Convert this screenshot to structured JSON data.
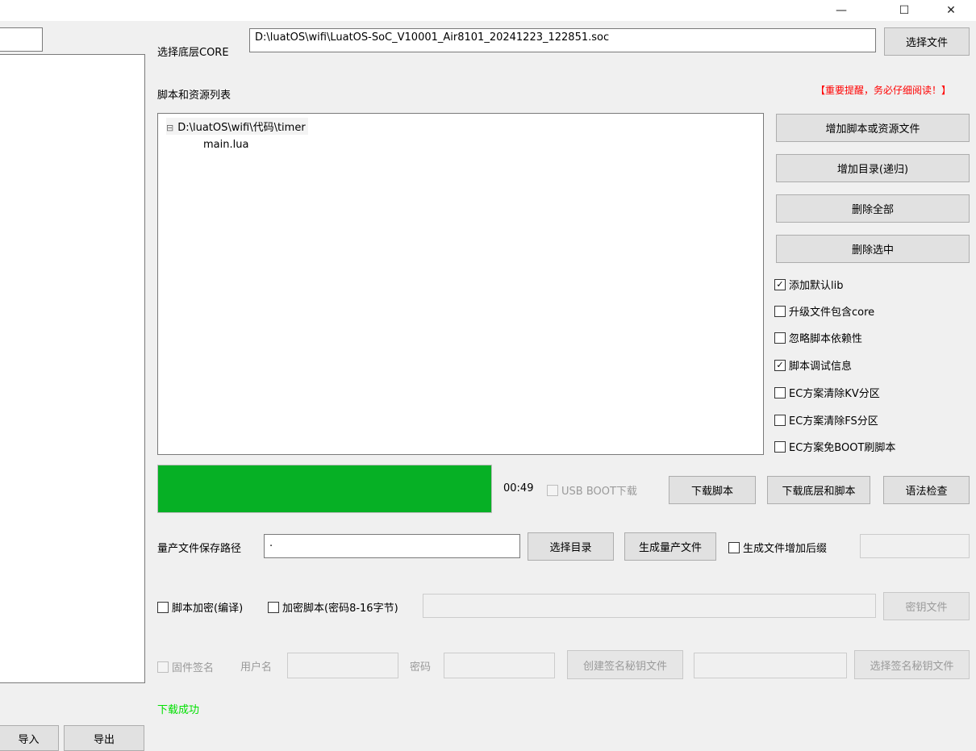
{
  "window": {
    "minimize_glyph": "—",
    "maximize_glyph": "☐",
    "close_glyph": "✕"
  },
  "core": {
    "label": "选择底层CORE",
    "path_value": "D:\\luatOS\\wifi\\LuatOS-SoC_V10001_Air8101_20241223_122851.soc",
    "select_button": "选择文件"
  },
  "scripts": {
    "label": "脚本和资源列表",
    "warning": "【重要提醒，务必仔细阅读！】",
    "tree": {
      "root_toggle": "⊟",
      "root_label": "D:\\luatOS\\wifi\\代码\\timer",
      "child_label": "main.lua"
    },
    "buttons": {
      "add_file": "增加脚本或资源文件",
      "add_dir": "增加目录(递归)",
      "delete_all": "删除全部",
      "delete_selected": "删除选中"
    },
    "options": [
      {
        "label": "添加默认lib",
        "checked": true
      },
      {
        "label": "升级文件包含core",
        "checked": false
      },
      {
        "label": "忽略脚本依赖性",
        "checked": false
      },
      {
        "label": "脚本调试信息",
        "checked": true
      },
      {
        "label": "EC方案清除KV分区",
        "checked": false
      },
      {
        "label": "EC方案清除FS分区",
        "checked": false
      },
      {
        "label": "EC方案免BOOT刷脚本",
        "checked": false
      }
    ]
  },
  "download": {
    "progress": 1.0,
    "progress_color": "#06b025",
    "elapsed": "00:49",
    "usb_boot_label": "USB BOOT下载",
    "download_script": "下载脚本",
    "download_core_and_script": "下载底层和脚本",
    "syntax_check": "语法检查"
  },
  "production": {
    "label": "量产文件保存路径",
    "path_value": ".",
    "select_dir": "选择目录",
    "generate": "生成量产文件",
    "suffix_label": "生成文件增加后缀"
  },
  "encryption": {
    "compile_encrypt": "脚本加密(编译)",
    "encrypt_script": "加密脚本(密码8-16字节)",
    "key_file": "密钥文件"
  },
  "signing": {
    "firmware_sign": "固件签名",
    "username_label": "用户名",
    "password_label": "密码",
    "create_key": "创建签名秘钥文件",
    "select_key": "选择签名秘钥文件"
  },
  "status": {
    "text": "下载成功",
    "color": "#00e000"
  },
  "left_panel": {
    "import": "导入",
    "export": "导出"
  }
}
